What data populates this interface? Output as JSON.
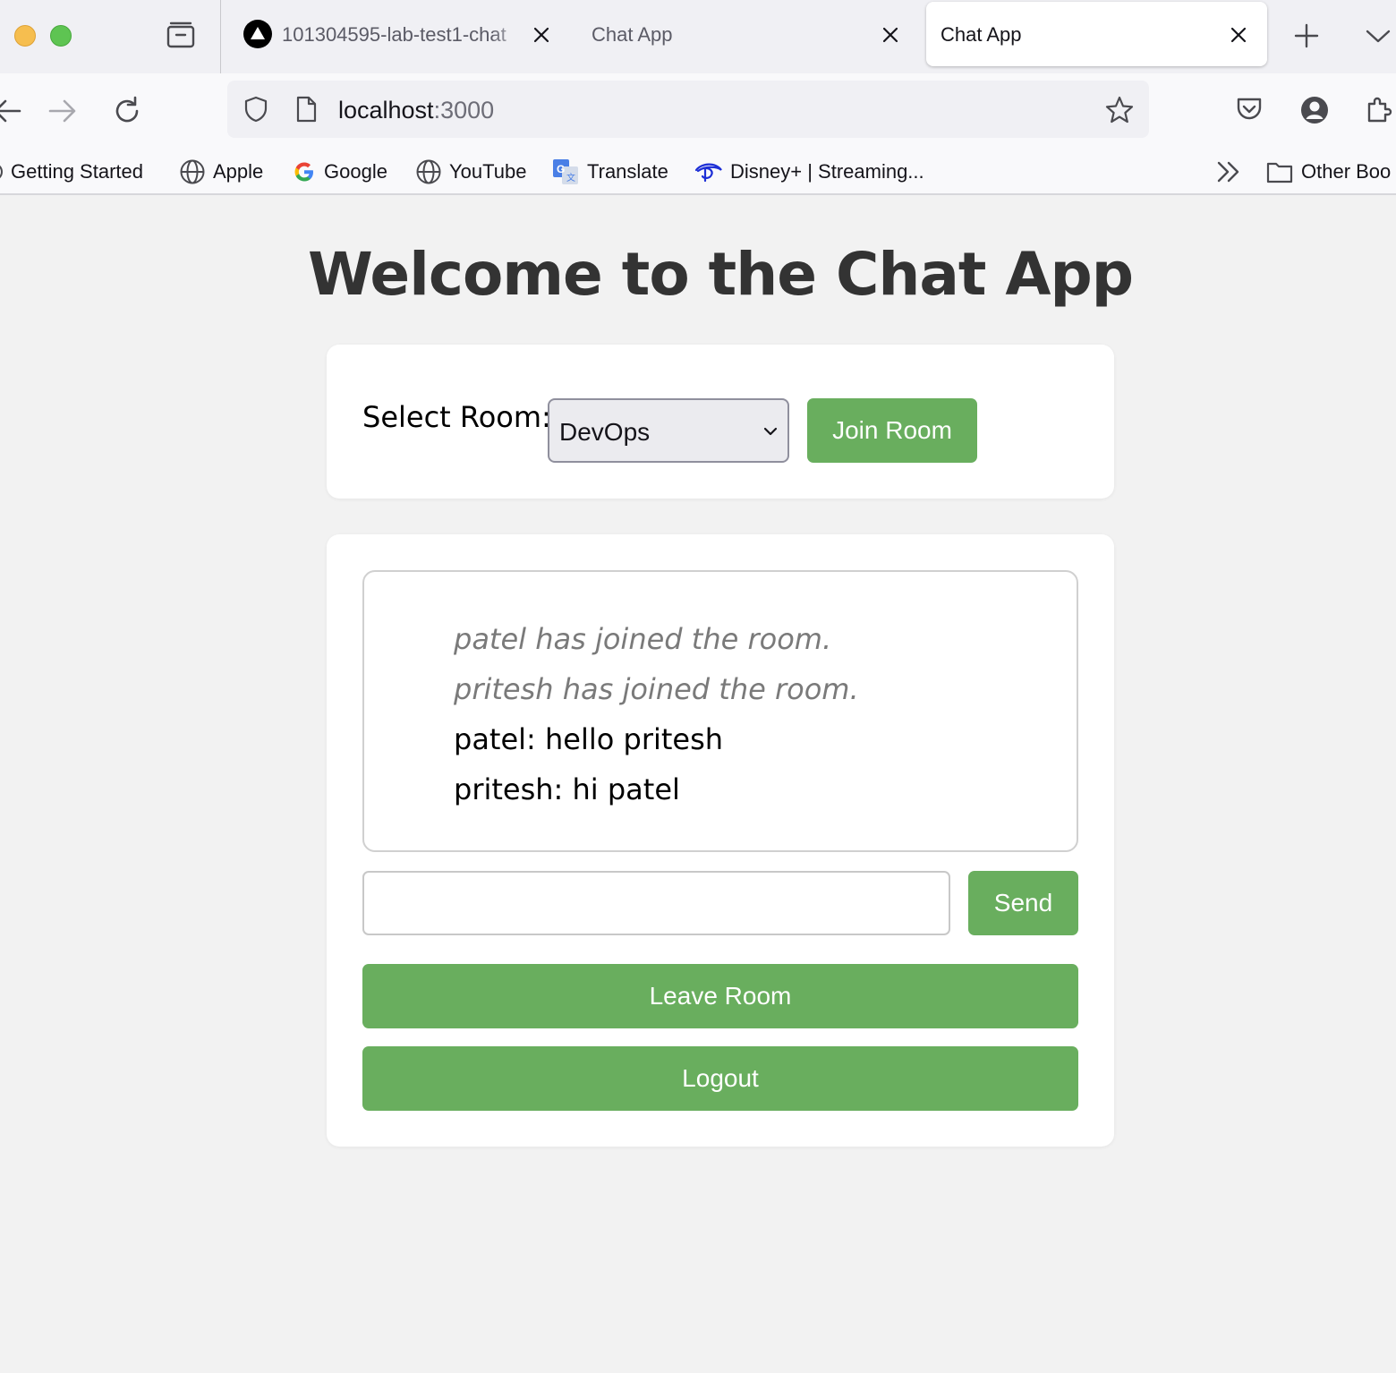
{
  "browser": {
    "tabs": [
      {
        "title": "101304595-lab-test1-chat",
        "active": false
      },
      {
        "title": "Chat App",
        "active": false
      },
      {
        "title": "Chat App",
        "active": true
      }
    ],
    "url": {
      "host": "localhost",
      "port": ":3000"
    },
    "bookmarks": [
      {
        "label": "Getting Started",
        "icon": "firefox-icon"
      },
      {
        "label": "Apple",
        "icon": "globe-icon"
      },
      {
        "label": "Google",
        "icon": "google-icon"
      },
      {
        "label": "YouTube",
        "icon": "globe-icon"
      },
      {
        "label": "Translate",
        "icon": "translate-icon"
      },
      {
        "label": "Disney+ | Streaming...",
        "icon": "disney-icon"
      }
    ],
    "other_bookmarks": "Other Boo"
  },
  "page": {
    "title": "Welcome to the Chat App",
    "room": {
      "label": "Select Room:",
      "selected": "DevOps",
      "join_label": "Join Room"
    },
    "messages": [
      {
        "text": "patel has joined the room.",
        "type": "system"
      },
      {
        "text": "pritesh has joined the room.",
        "type": "system"
      },
      {
        "text": "patel: hello pritesh",
        "type": "chat"
      },
      {
        "text": "pritesh: hi patel",
        "type": "chat"
      }
    ],
    "input": {
      "value": "",
      "placeholder": ""
    },
    "send_label": "Send",
    "leave_label": "Leave Room",
    "logout_label": "Logout"
  },
  "colors": {
    "accent": "#69ae5e",
    "title": "#333333",
    "system_message": "#7a7a7a",
    "background": "#f2f2f2"
  }
}
